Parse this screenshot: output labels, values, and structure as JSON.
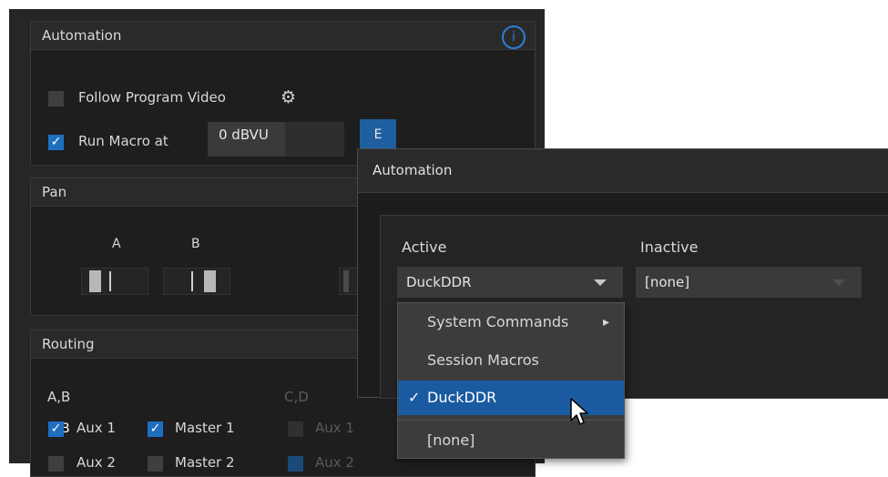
{
  "automation": {
    "title": "Automation",
    "follow_label": "Follow Program Video",
    "run_macro_label": "Run Macro at",
    "level_value": "0 dBVU",
    "e_button": "E",
    "info_glyph": "i",
    "check_glyph": "✓",
    "gear_glyph": "⚙"
  },
  "pan": {
    "title": "Pan",
    "channel_a": "A",
    "channel_b": "B"
  },
  "routing": {
    "title": "Routing",
    "group1": "A,B",
    "group2": "C,D",
    "aux1": "Aux 1",
    "master1": "Master 1",
    "aux2": "Aux 2",
    "master2": "Master 2",
    "aux1_cd": "Aux 1"
  },
  "popup": {
    "title": "Automation",
    "active_label": "Active",
    "inactive_label": "Inactive",
    "active_value": "DuckDDR",
    "inactive_value": "[none]"
  },
  "menu": {
    "system_commands": "System Commands",
    "submenu_glyph": "▸",
    "session_macros": "Session Macros",
    "check_glyph": "✓",
    "duckddr": "DuckDDR",
    "none": "[none]"
  },
  "colors": {
    "accent": "#1f6fc1",
    "selection": "#1a5aa0",
    "panel": "#262626"
  }
}
